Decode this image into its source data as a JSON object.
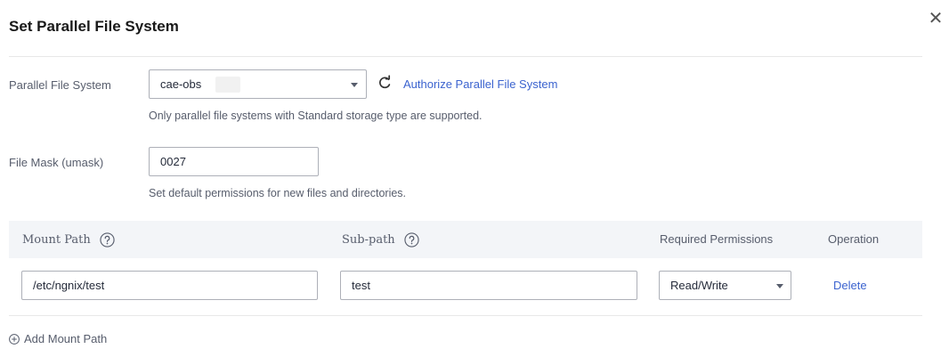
{
  "dialog": {
    "title": "Set Parallel File System",
    "close_icon": "close-icon"
  },
  "form": {
    "pfs": {
      "label": "Parallel File System",
      "selected_value": "cae-obs",
      "refresh_icon": "refresh-icon",
      "authorize_link": "Authorize Parallel File System",
      "hint": "Only parallel file systems with Standard storage type are supported."
    },
    "umask": {
      "label": "File Mask (umask)",
      "value": "0027",
      "hint": "Set default permissions for new files and directories."
    }
  },
  "table": {
    "columns": {
      "mount_path": "Mount Path",
      "sub_path": "Sub-path",
      "permissions": "Required Permissions",
      "operation": "Operation"
    },
    "help_icon": "question-circle-icon",
    "rows": [
      {
        "mount_path": "/etc/ngnix/test",
        "sub_path": "test",
        "permission": "Read/Write",
        "delete_label": "Delete"
      }
    ]
  },
  "actions": {
    "add_label": "Add Mount Path",
    "add_icon": "plus-circle-icon"
  },
  "colors": {
    "link": "#3b63cf",
    "header_bg": "#f3f5f8",
    "border": "#adb0b8"
  }
}
